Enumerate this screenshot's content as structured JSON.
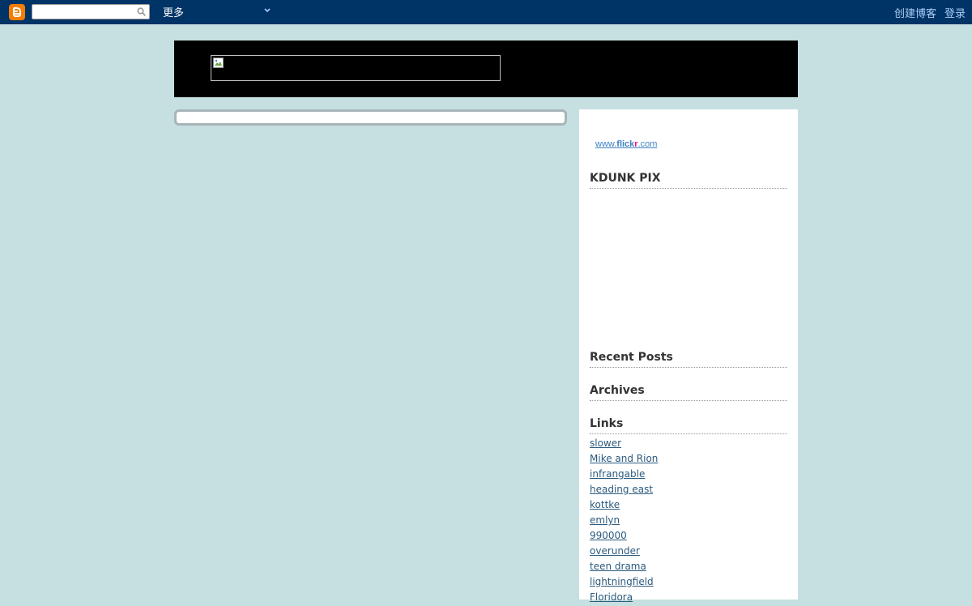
{
  "navbar": {
    "search_placeholder": "",
    "more_label": "更多",
    "create_blog_label": "创建博客",
    "login_label": "登录"
  },
  "colors": {
    "navbar_bg": "#003366",
    "page_bg": "#c6dfe0",
    "blogger_orange": "#f57d00",
    "link_color": "#2b5a7e"
  },
  "sidebar": {
    "flickr": {
      "prefix": "www.",
      "flick": "flick",
      "r": "r",
      "suffix": ".com"
    },
    "headings": {
      "kdunk": "KDUNK PIX",
      "recent": "Recent Posts",
      "archives": "Archives",
      "links": "Links"
    },
    "links": [
      "slower",
      "Mike and Rion",
      "infrangable",
      "heading east",
      "kottke",
      "emlyn",
      "990000",
      "overunder",
      "teen drama",
      "lightningfield",
      "Floridora"
    ]
  }
}
